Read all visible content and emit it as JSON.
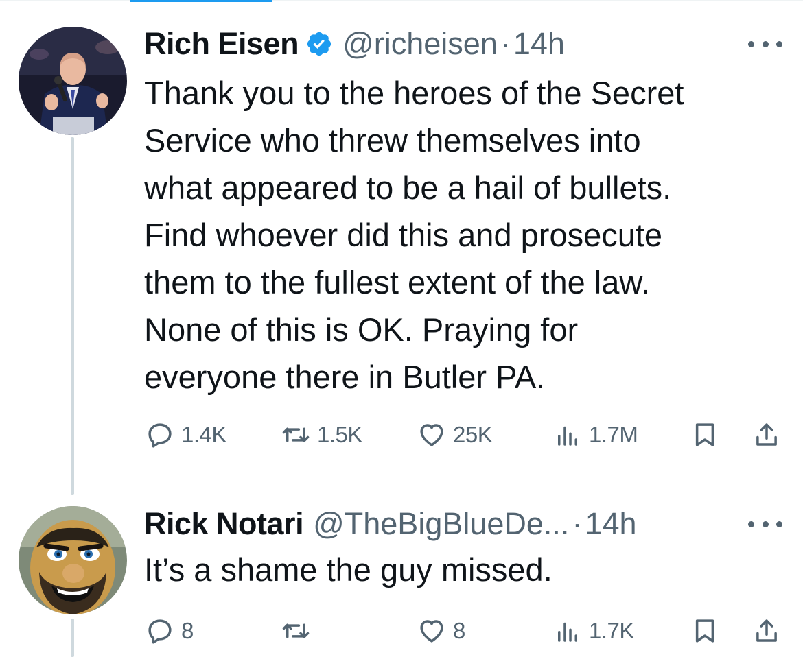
{
  "tweets": [
    {
      "display_name": "Rich Eisen",
      "verified": true,
      "handle": "@richeisen",
      "separator": "·",
      "time": "14h",
      "text_lines": [
        "Thank you to the heroes of the Secret",
        "Service who threw themselves into",
        "what appeared to be a hail of bullets.",
        "Find whoever did this and prosecute",
        "them to the fullest extent of the law.",
        "None of this is OK. Praying for",
        "everyone there in Butler PA."
      ],
      "actions": {
        "reply_count": "1.4K",
        "retweet_count": "1.5K",
        "like_count": "25K",
        "views_count": "1.7M"
      },
      "avatar_icon": "person-at-microphone-photo"
    },
    {
      "display_name": "Rick Notari",
      "verified": false,
      "handle": "@TheBigBlueDe...",
      "separator": "·",
      "time": "14h",
      "text_lines": [
        "It’s a shame the guy missed."
      ],
      "actions": {
        "reply_count": "8",
        "retweet_count": "",
        "like_count": "8",
        "views_count": "1.7K"
      },
      "avatar_icon": "bearded-mascot-photo"
    }
  ],
  "colors": {
    "accent": "#1d9bf0",
    "secondary_text": "#536471",
    "primary_text": "#0f1419",
    "thread_line": "#cfd9de"
  },
  "icons": [
    "verified-badge-icon",
    "more-icon",
    "reply-icon",
    "retweet-icon",
    "like-icon",
    "views-icon",
    "bookmark-icon",
    "share-icon"
  ]
}
